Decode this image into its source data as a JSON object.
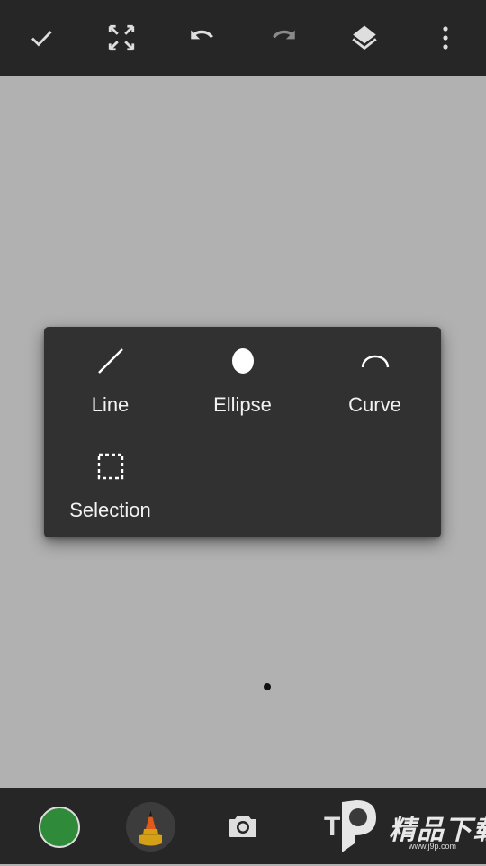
{
  "toolbar": {
    "confirm_icon": "check-icon",
    "fullscreen_icon": "fullscreen-icon",
    "undo_icon": "undo-icon",
    "redo_icon": "redo-icon",
    "layers_icon": "layers-icon",
    "more_icon": "more-vertical-icon"
  },
  "shape_menu": {
    "items": [
      {
        "label": "Line",
        "icon": "line-icon"
      },
      {
        "label": "Ellipse",
        "icon": "ellipse-icon"
      },
      {
        "label": "Curve",
        "icon": "curve-icon"
      },
      {
        "label": "Selection",
        "icon": "selection-icon"
      }
    ]
  },
  "bottom_bar": {
    "color": "#2f8a3a",
    "brush_icon": "pencil-brush-icon",
    "camera_icon": "camera-icon",
    "text_tool_label": "T",
    "watermark": {
      "main": "精品下载",
      "sub": "www.j9p.com"
    }
  },
  "colors": {
    "toolbar_bg": "#262626",
    "canvas_bg": "#b1b1b1",
    "popup_bg": "#313131",
    "icon_active": "#dedede",
    "icon_disabled": "#8a8a8a"
  }
}
